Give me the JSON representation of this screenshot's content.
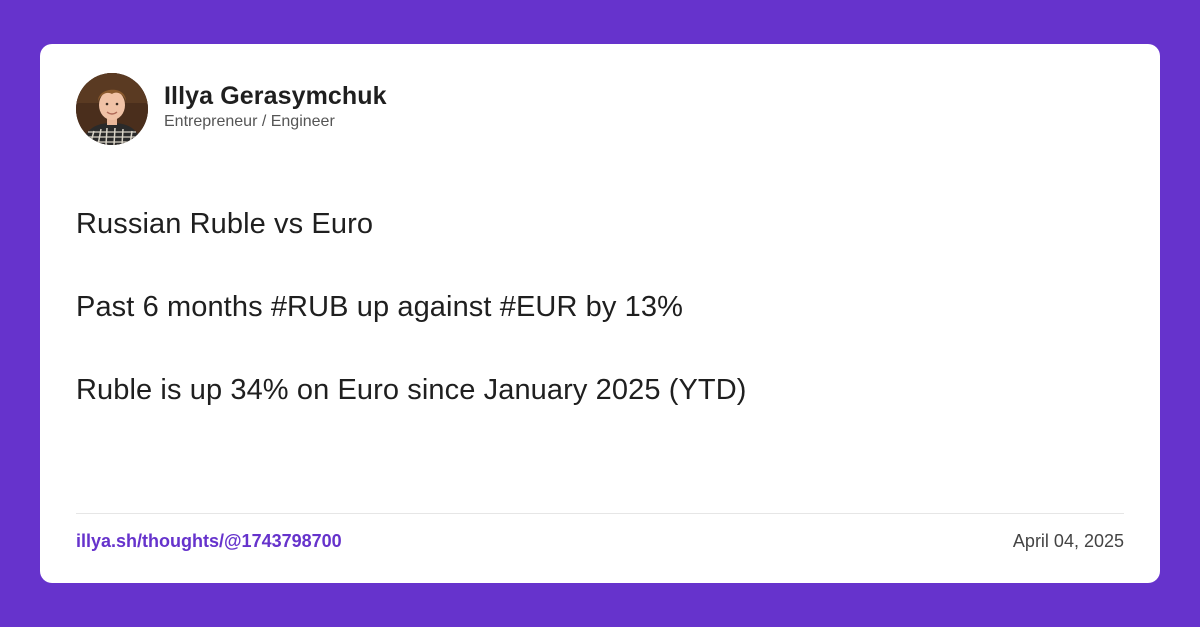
{
  "colors": {
    "background": "#6633cc",
    "card": "#ffffff",
    "link": "#6633cc",
    "text": "#1f1f1f"
  },
  "author": {
    "name": "Illya Gerasymchuk",
    "role": "Entrepreneur / Engineer",
    "avatar_icon": "avatar-photo"
  },
  "post": {
    "lines": [
      "Russian Ruble vs Euro",
      "Past 6 months #RUB up against #EUR by 13%",
      "Ruble is up 34% on Euro since January 2025 (YTD)"
    ]
  },
  "footer": {
    "link": "illya.sh/thoughts/@1743798700",
    "date": "April 04, 2025"
  }
}
